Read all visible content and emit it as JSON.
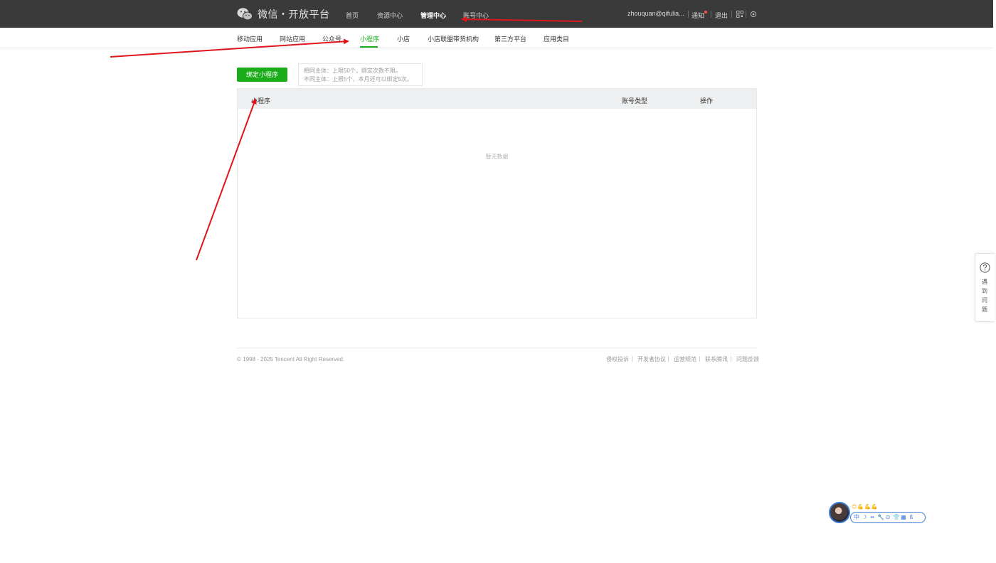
{
  "header": {
    "logo_text": "微信・开放平台",
    "nav": [
      "首页",
      "资源中心",
      "管理中心",
      "账号中心"
    ],
    "active_nav": "管理中心",
    "user_email": "zhouquan@qifulia...",
    "notice_label": "通知",
    "logout_label": "退出"
  },
  "subnav": {
    "items": [
      "移动应用",
      "网站应用",
      "公众号",
      "小程序",
      "小店",
      "小店联盟带货机构",
      "第三方平台",
      "应用类目"
    ],
    "active": "小程序"
  },
  "main": {
    "bind_button": "绑定小程序",
    "tips": [
      "相同主体：上限50个，绑定次数不限。",
      "不同主体：上限5个，本月还可以绑定5次。"
    ],
    "table": {
      "columns": [
        "小程序",
        "账号类型",
        "操作"
      ],
      "empty_text": "暂无数据"
    }
  },
  "footer": {
    "copyright": "© 1998 - 2025 Tencent All Right Reserved.",
    "links": [
      "侵权投诉",
      "开发者协议",
      "运营规范",
      "联系腾讯",
      "问题反馈"
    ]
  },
  "help_widget": {
    "label": "遇到问题"
  },
  "float_toolbar": {
    "emojis": "😊💪💪💪",
    "items": [
      "中",
      "☽",
      "••",
      "🔧",
      "⊙",
      "👕",
      "▦",
      "ß"
    ]
  },
  "colors": {
    "topbar": "#3a3a3a",
    "accent_green": "#1aad19",
    "annotation_red": "#e0161c"
  }
}
